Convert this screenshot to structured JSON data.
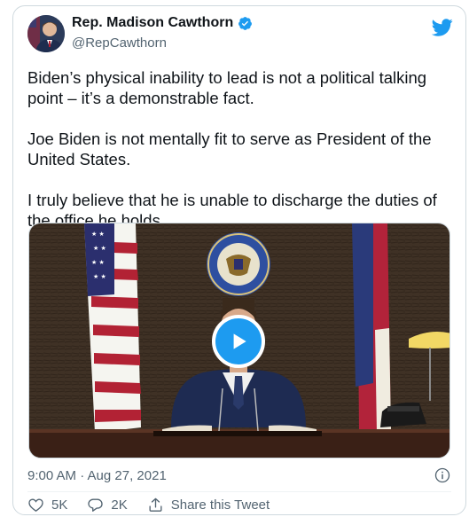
{
  "author": {
    "name": "Rep. Madison Cawthorn",
    "handle": "@RepCawthorn"
  },
  "tweet": {
    "paragraphs": [
      "Biden’s physical inability to lead is not a political talking point – it’s a demonstrable fact.",
      "Joe Biden is not mentally fit to serve as President of the United States.",
      "I truly believe that he is unable to discharge the duties of the office he holds."
    ],
    "timestamp": "9:00 AM · Aug 27, 2021"
  },
  "media": {
    "seal_text": "HOUSE OF REPRESENTATIVES · UNITED STATES OF AMERICA"
  },
  "actions": {
    "likes": "5K",
    "replies": "2K",
    "share_label": "Share this Tweet"
  },
  "colors": {
    "accent": "#1d9bf0",
    "text": "#0f1419",
    "secondary": "#536471",
    "border": "#cfd9de"
  },
  "icons": [
    "verified-badge-icon",
    "twitter-bird-icon",
    "play-icon",
    "info-icon",
    "heart-icon",
    "reply-icon",
    "share-icon"
  ]
}
